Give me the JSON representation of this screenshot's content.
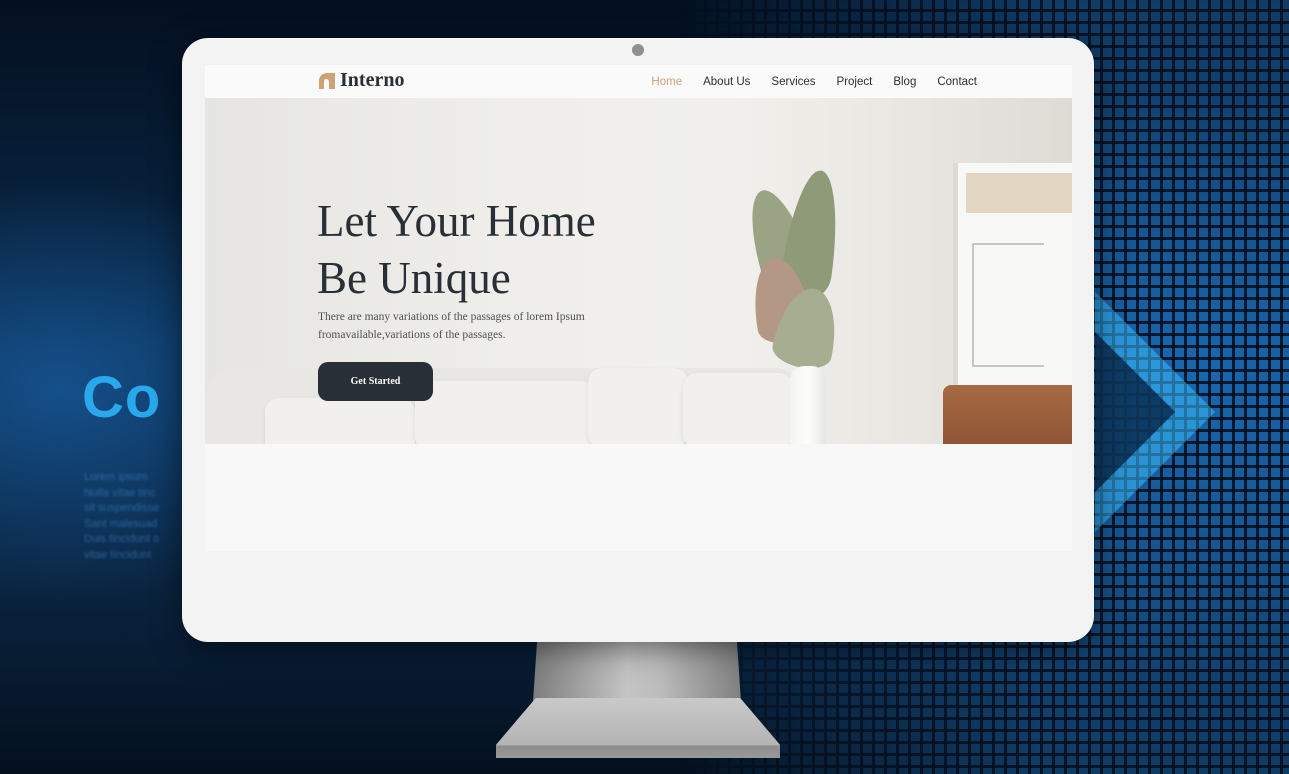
{
  "background": {
    "headline": "Co",
    "lines": [
      "Lorem ipsum",
      "Nulla vitae tinc",
      "sit suspendisse",
      "Sant malesuad",
      "Duis tincidunt o",
      "vitae tincidunt"
    ],
    "accent_color": "#29a8ec"
  },
  "site": {
    "logo_text": "Interno",
    "logo_icon": "arch-icon",
    "nav": [
      {
        "label": "Home",
        "active": true
      },
      {
        "label": "About Us",
        "active": false
      },
      {
        "label": "Services",
        "active": false
      },
      {
        "label": "Project",
        "active": false
      },
      {
        "label": "Blog",
        "active": false
      },
      {
        "label": "Contact",
        "active": false
      }
    ],
    "hero": {
      "title_line1": "Let Your Home",
      "title_line2": "Be Unique",
      "description": "There are many variations of the passages of lorem Ipsum fromavailable,variations of the passages.",
      "button_label": "Get Started"
    },
    "colors": {
      "accent": "#cda274",
      "dark": "#292f36"
    }
  }
}
